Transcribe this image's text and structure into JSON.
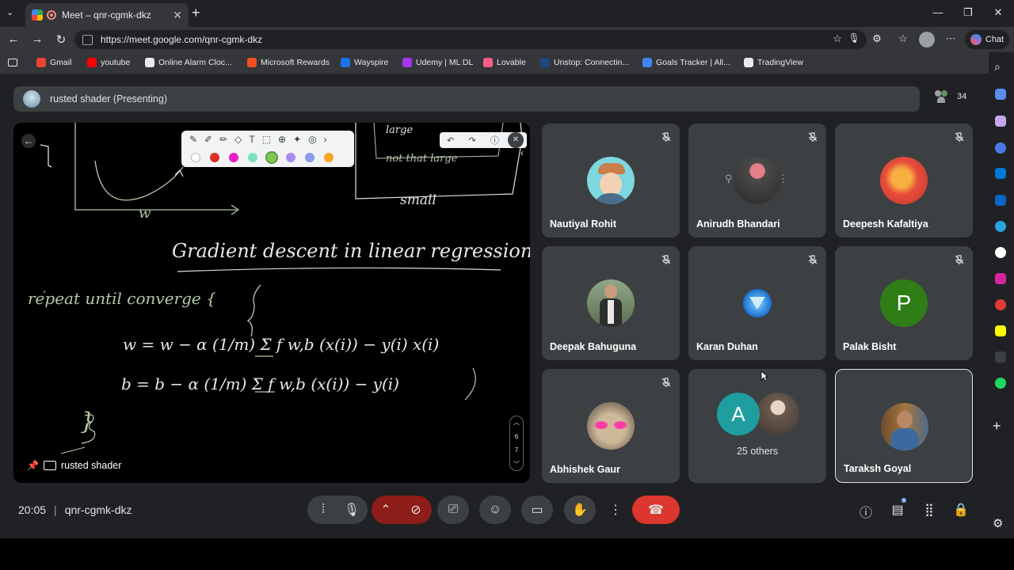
{
  "browser": {
    "tab_title": "Meet – qnr-cgmk-dkz",
    "url": "https://meet.google.com/qnr-cgmk-dkz",
    "chat_label": "Chat",
    "bookmarks": [
      {
        "label": "Gmail",
        "icon": "gmail-icon",
        "color": "#ea4335"
      },
      {
        "label": "youtube",
        "icon": "youtube-icon",
        "color": "#ff0000"
      },
      {
        "label": "Online Alarm Cloc...",
        "icon": "clock-icon",
        "color": "#e8eaed"
      },
      {
        "label": "Microsoft Rewards",
        "icon": "rewards-icon",
        "color": "#f25022"
      },
      {
        "label": "Wayspire",
        "icon": "wayspire-icon",
        "color": "#1a73e8"
      },
      {
        "label": "Udemy | ML DL",
        "icon": "udemy-icon",
        "color": "#a435f0"
      },
      {
        "label": "Lovable",
        "icon": "lovable-icon",
        "color": "#ff5c8a"
      },
      {
        "label": "Unstop: Connectin...",
        "icon": "unstop-icon",
        "color": "#1c4980"
      },
      {
        "label": "Goals Tracker | All...",
        "icon": "goals-icon",
        "color": "#4285f4"
      },
      {
        "label": "TradingView",
        "icon": "tradingview-icon",
        "color": "#e8eaed"
      }
    ]
  },
  "meet": {
    "presenting_banner": "rusted shader (Presenting)",
    "participant_count": "34",
    "presenter_name": "rusted shader",
    "whiteboard": {
      "title": "Gradient descent in linear regression",
      "line1": "repeat until converge {",
      "eq1": "w = w − α (1/m) Σ f w,b (x(i)) − y(i) x(i)",
      "eq2": "b = b − α (1/m) Σ f w,b (x(i)) − y(i)",
      "close": "}",
      "axis_label": "w",
      "top_words": [
        "large",
        "not that large",
        "small"
      ]
    },
    "page_indicator": [
      "6",
      "7"
    ],
    "others_label": "25 others",
    "others_initial": "A",
    "participants": [
      {
        "name": "Nautiyal Rohit"
      },
      {
        "name": "Anirudh Bhandari"
      },
      {
        "name": "Deepesh Kafaltiya"
      },
      {
        "name": "Deepak Bahuguna"
      },
      {
        "name": "Karan Duhan"
      },
      {
        "name": "Palak Bisht",
        "initial": "P"
      },
      {
        "name": "Abhishek Gaur"
      },
      {
        "name": "Taraksh Goyal"
      }
    ],
    "time": "20:05",
    "meeting_code": "qnr-cgmk-dkz"
  },
  "colors": {
    "end_call": "#dc362e",
    "camera_off": "#8c1d18",
    "palak_avatar": "#2f7d16",
    "others_avatar": "#1e9e9e"
  }
}
